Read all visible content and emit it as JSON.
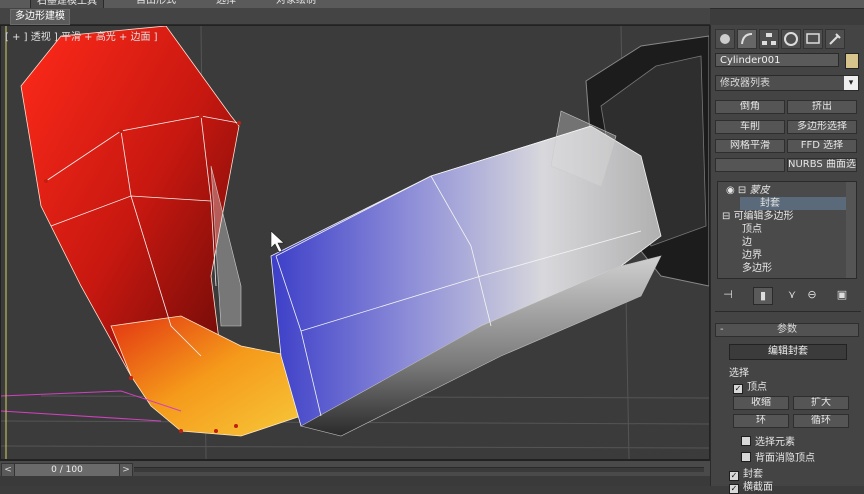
{
  "menu": {
    "tabs": [
      "石墨建模工具",
      "自由形式",
      "选择",
      "对象绘制"
    ],
    "active_tab": "多边形建模"
  },
  "viewport": {
    "label": "[ + ] 透视 ] 平滑 + 高光 + 边面 ]"
  },
  "timeline": {
    "frame": "0 / 100",
    "prev": "<",
    "next": ">"
  },
  "panel": {
    "object_name": "Cylinder001",
    "modifier_list": "修改器列表",
    "dropdown_arrow": "▾",
    "buttons": [
      "倒角",
      "挤出",
      "车削",
      "多边形选择",
      "网格平滑",
      "FFD 选择",
      "",
      "NURBS 曲面选择"
    ],
    "stack": {
      "items": [
        {
          "label": "蒙皮",
          "style": "italic"
        },
        {
          "label": "封套",
          "style": "selected"
        },
        {
          "label": "可编辑多边形",
          "style": "normal"
        },
        {
          "label": "顶点",
          "style": "sub"
        },
        {
          "label": "边",
          "style": "sub"
        },
        {
          "label": "边界",
          "style": "sub"
        },
        {
          "label": "多边形",
          "style": "sub"
        }
      ]
    },
    "params": {
      "header": "参数",
      "collapse": "-",
      "edit_envelope": "编辑封套",
      "selection_label": "选择",
      "vertex_checkbox": "顶点",
      "shrink": "收缩",
      "grow": "扩大",
      "ring": "环",
      "loop": "循环",
      "select_element": "选择元素",
      "backface_cull": "背面消隐顶点",
      "envelope": "封套",
      "cross_section": "横截面"
    }
  },
  "colors": {
    "background": "#3b3b3b",
    "panel": "#444444",
    "accent_red": "#d01c10",
    "accent_blue": "#4a4fb0",
    "swatch": "#d6c48c"
  }
}
